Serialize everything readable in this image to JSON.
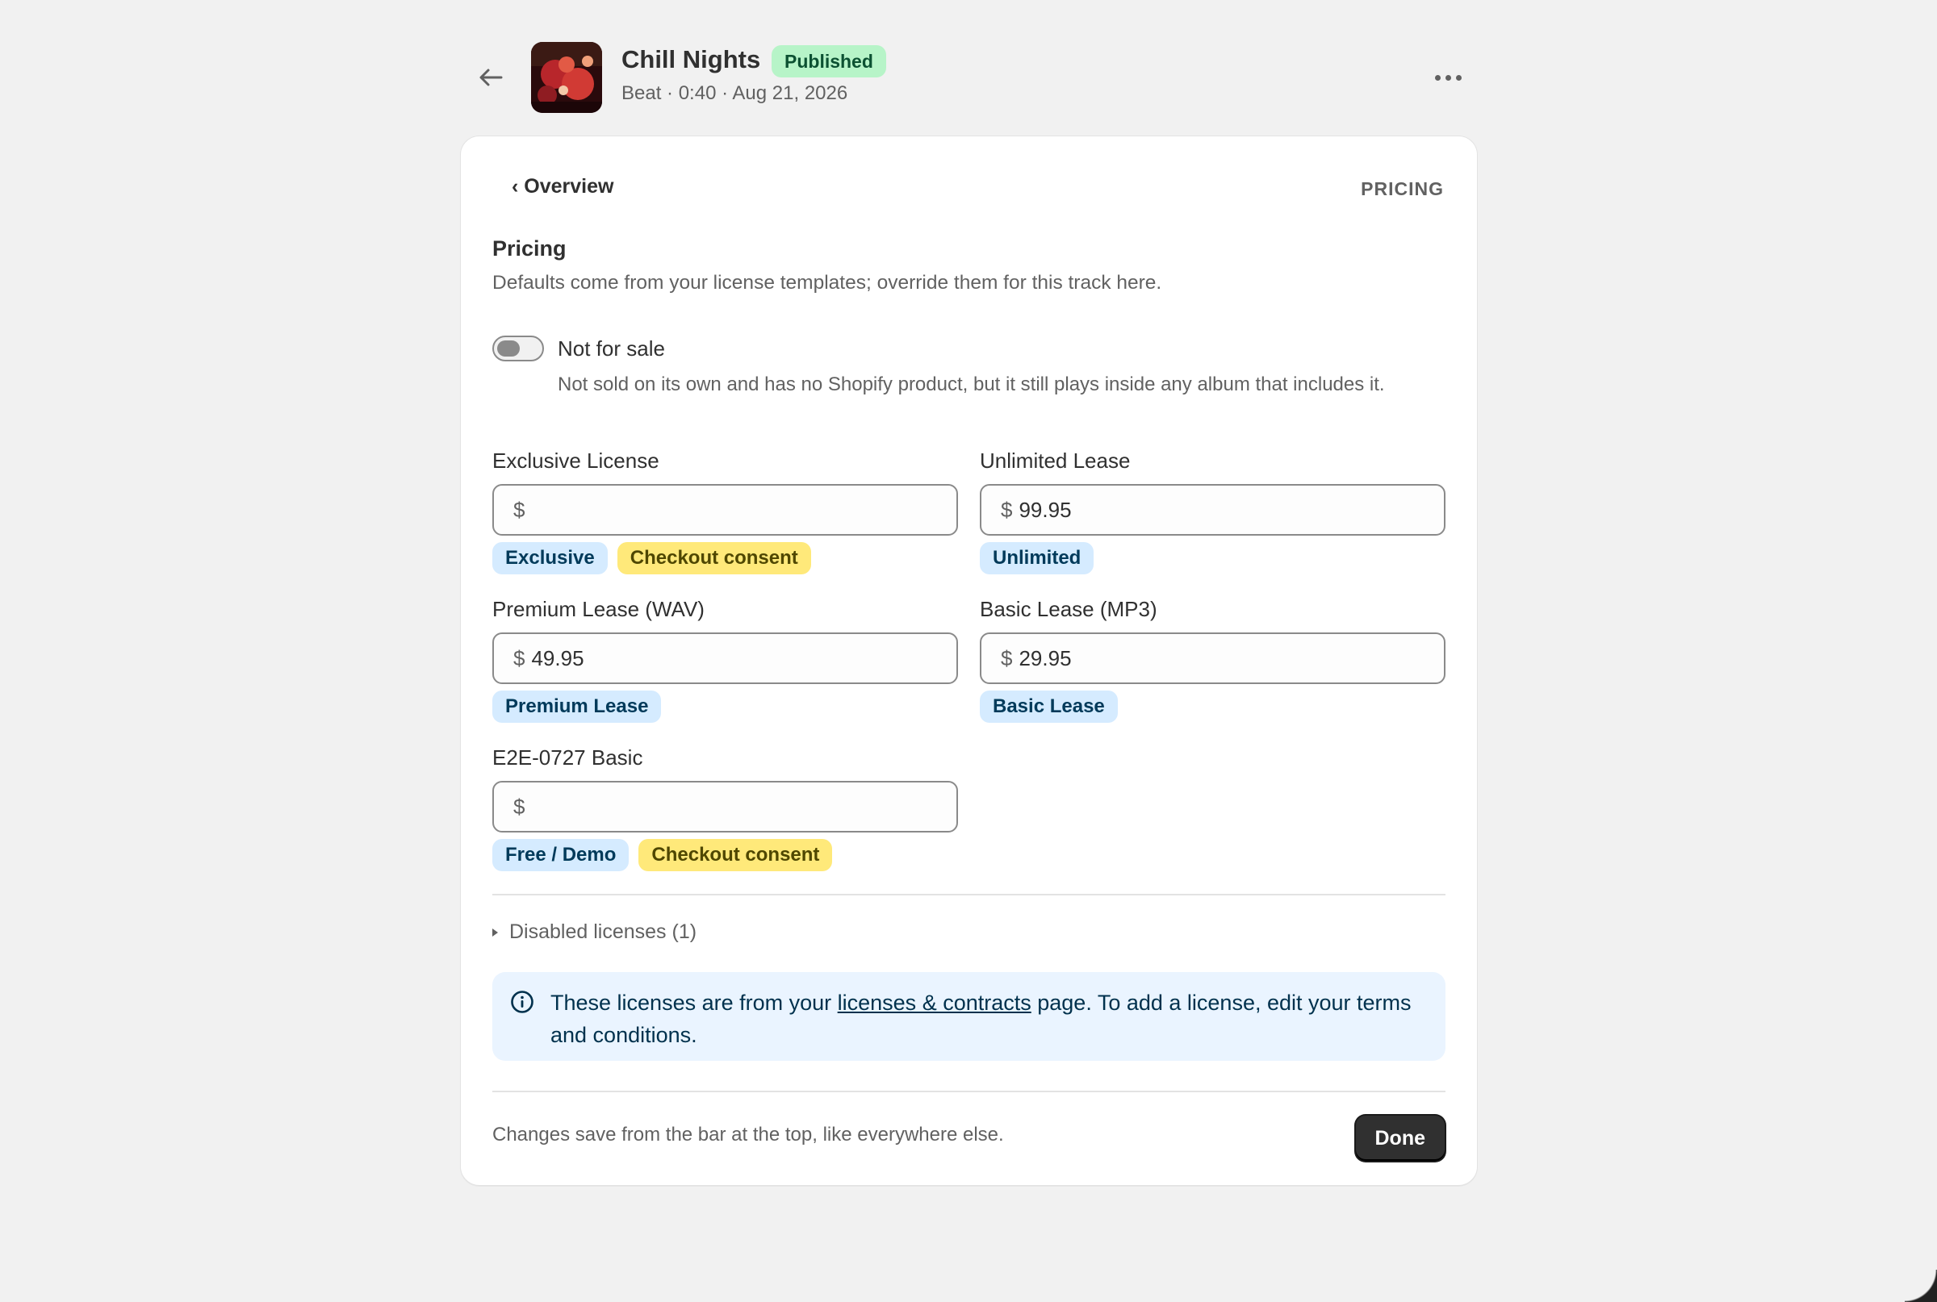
{
  "header": {
    "title": "Chill Nights",
    "status": "Published",
    "meta": "Beat · 0:40 · Aug 21, 2026",
    "icons": {
      "back": "arrow-left-icon",
      "more": "ellipsis-horizontal-icon"
    }
  },
  "card": {
    "breadcrumb": "‹ Overview",
    "section_tag": "PRICING",
    "title": "Pricing",
    "description": "Defaults come from your license templates; override them for this track here.",
    "not_for_sale": {
      "label": "Not for sale",
      "help": "Not sold on its own and has no Shopify product, but it still plays inside any album that includes it.",
      "enabled": false
    },
    "licenses": [
      {
        "name": "Exclusive License",
        "currency": "$",
        "value": "",
        "tags": [
          {
            "text": "Exclusive",
            "color": "blue"
          },
          {
            "text": "Checkout consent",
            "color": "yellow"
          }
        ]
      },
      {
        "name": "Unlimited Lease",
        "currency": "$",
        "value": "99.95",
        "tags": [
          {
            "text": "Unlimited",
            "color": "blue"
          }
        ]
      },
      {
        "name": "Premium Lease (WAV)",
        "currency": "$",
        "value": "49.95",
        "tags": [
          {
            "text": "Premium Lease",
            "color": "blue"
          }
        ]
      },
      {
        "name": "Basic Lease (MP3)",
        "currency": "$",
        "value": "29.95",
        "tags": [
          {
            "text": "Basic Lease",
            "color": "blue"
          }
        ]
      },
      {
        "name": "E2E-0727 Basic",
        "currency": "$",
        "value": "",
        "tags": [
          {
            "text": "Free / Demo",
            "color": "blue"
          },
          {
            "text": "Checkout consent",
            "color": "yellow"
          }
        ]
      }
    ],
    "disabled_licenses": "Disabled licenses (1)",
    "banner": {
      "before": "These licenses are from your ",
      "link": "licenses & contracts",
      "after": " page. To add a license, edit your terms and conditions."
    },
    "footer_note": "Changes save from the bar at the top, like everywhere else.",
    "done_label": "Done"
  },
  "colors": {
    "background": "#f1f1f1",
    "published_badge": "#b7f4c8",
    "tag_blue": "#d5ebff",
    "tag_yellow": "#ffe97a",
    "banner_bg": "#eaf4ff",
    "primary_button": "#303030"
  }
}
